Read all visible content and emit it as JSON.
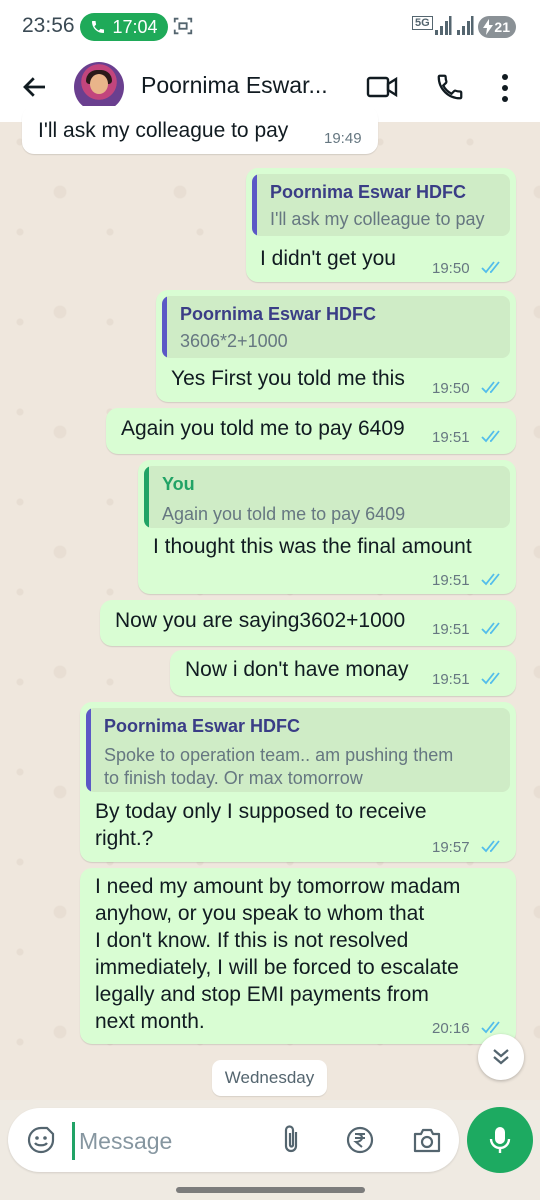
{
  "status_bar": {
    "time": "23:56",
    "call_duration": "17:04",
    "network": "5G",
    "battery": "21"
  },
  "header": {
    "contact_name": "Poornima Eswar...",
    "icons": [
      "back-arrow-icon",
      "video-call-icon",
      "phone-icon",
      "more-options-icon"
    ]
  },
  "messages": [
    {
      "dir": "in",
      "text": "I'll ask my colleague to pay",
      "time": "19:49"
    },
    {
      "dir": "out",
      "quote_author": "Poornima Eswar HDFC",
      "quote_text": "I'll ask my colleague to pay",
      "text": "I didn't get you",
      "time": "19:50",
      "ticks": "read"
    },
    {
      "dir": "out",
      "quote_author": "Poornima Eswar HDFC",
      "quote_text": "3606*2+1000",
      "text": "Yes First you told me this",
      "time": "19:50",
      "ticks": "read"
    },
    {
      "dir": "out",
      "text": "Again you told me to pay 6409",
      "time": "19:51",
      "ticks": "read"
    },
    {
      "dir": "out",
      "quote_author": "You",
      "quote_text": "Again you told me to pay 6409",
      "text": "I thought this was the final amount",
      "time": "19:51",
      "ticks": "read"
    },
    {
      "dir": "out",
      "text": "Now you are saying3602+1000",
      "time": "19:51",
      "ticks": "read"
    },
    {
      "dir": "out",
      "text": "Now i don't have monay",
      "time": "19:51",
      "ticks": "read"
    },
    {
      "dir": "out",
      "quote_author": "Poornima Eswar HDFC",
      "quote_lines": [
        "Spoke to operation team.. am pushing them",
        "to finish today. Or max tomorrow"
      ],
      "lines": [
        "By today only I supposed to receive",
        "right.?"
      ],
      "time": "19:57",
      "ticks": "read"
    },
    {
      "dir": "out",
      "lines": [
        "I need my amount by tomorrow madam",
        "anyhow, or you speak to whom that",
        "I don't know. If this is not resolved",
        "immediately, I will be forced to escalate",
        "legally and stop EMI payments from",
        "next month."
      ],
      "time": "20:16",
      "ticks": "read"
    }
  ],
  "date_chip": "Wednesday",
  "composer": {
    "placeholder": "Message",
    "icons": [
      "emoji-sticker-icon",
      "attach-icon",
      "rupee-payment-icon",
      "camera-icon",
      "mic-icon"
    ]
  },
  "colors": {
    "outgoing_bubble": "#d9fdd3",
    "incoming_bubble": "#ffffff",
    "read_tick": "#53bdeb",
    "accent_green": "#1daa61",
    "quote_bar": "#5b58c6"
  }
}
